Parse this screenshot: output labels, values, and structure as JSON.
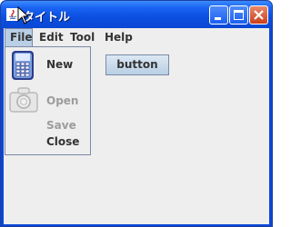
{
  "window": {
    "title": "タイトル"
  },
  "menubar": {
    "items": [
      "File",
      "Edit",
      "Tool",
      "Help"
    ]
  },
  "file_menu": {
    "items": [
      {
        "label": "New",
        "enabled": true,
        "icon": "phone-icon"
      },
      {
        "label": "Open",
        "enabled": false,
        "icon": "camera-icon"
      },
      {
        "label": "Save",
        "enabled": false
      },
      {
        "label": "Close",
        "enabled": true
      }
    ]
  },
  "content": {
    "button_label": "button"
  },
  "colors": {
    "titlebar": "#0a48d4",
    "menu_highlight": "#b8cfe5",
    "close_button": "#cc3e1a"
  }
}
